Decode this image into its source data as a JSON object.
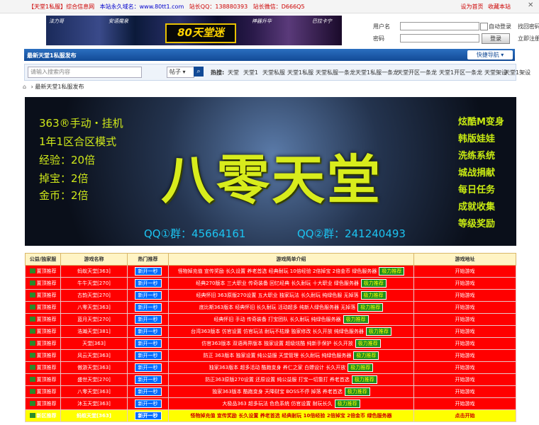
{
  "topbar": {
    "left": [
      "【天堂1私服】综合信息网",
      "本站永久域名：www.80tt1.com",
      "站长QQ：138880393",
      "站长微信：D666Q5"
    ],
    "right": [
      "设为首页",
      "收藏本站"
    ],
    "icon": "close-icon"
  },
  "banner": {
    "tags": [
      "法力哥",
      "安语魔泉",
      "神器升华",
      "巴拉卡宁"
    ],
    "logo": "80天堂迷"
  },
  "login": {
    "username_label": "用户名",
    "password_label": "密码",
    "auto_login": "自动登录",
    "find_password": "找回密码",
    "login_button": "登录",
    "register": "立即注册"
  },
  "navbar": {
    "title": "最新天堂1私服发布",
    "quick_nav": "快捷导航 ▾"
  },
  "search": {
    "placeholder": "请输入搜索内容",
    "select": "帖子 ▾",
    "hot_label": "热搜:",
    "hot_keywords": [
      "天堂",
      "天堂1",
      "天堂私服",
      "天堂1私服",
      "天堂私服一条龙",
      "天堂1私服一条龙",
      "天堂开区一条龙",
      "天堂1开区一条龙",
      "天堂架设",
      "天堂1架设"
    ]
  },
  "breadcrumb": {
    "separator": "›",
    "current": "最新天堂1私服发布"
  },
  "ad": {
    "left_lines": [
      "363®手动・挂机",
      "1年1区合区模式",
      "经验：20倍",
      "掉宝：2倍",
      "金币：2倍"
    ],
    "big": "八零天堂",
    "right_lines": [
      "炫酷M变身",
      "韩版娃娃",
      "洗练系统",
      "城战捐献",
      "每日任务",
      "成就收集",
      "等级奖励"
    ],
    "qq1": "QQ①群：45664161",
    "qq2": "QQ②群：241240493"
  },
  "table": {
    "headers": [
      "公益/独家服",
      "游戏名称",
      "热门推荐",
      "游戏简单介绍",
      "游戏地址"
    ],
    "rows": [
      {
        "tag": "置顶推荐",
        "name": "蚂蚁天堂[363]",
        "hot": "新开一秒",
        "desc": "怪物掉充值 宣传奖励 长久设置 养老首选 经典耐玩 10倍经验 2倍掉宝 2倍金币 绿色服务器",
        "rec": "极力推荐",
        "go": "开始游戏"
      },
      {
        "tag": "置顶推荐",
        "name": "牛牛天堂[270]",
        "hot": "新开一秒",
        "desc": "经典270版本 三大职业 传奇装备 回忆经典 长久耐玩 十大职业 绿色服务器",
        "rec": "极力推荐",
        "go": "开始游戏"
      },
      {
        "tag": "置顶推荐",
        "name": "古韵天堂[270]",
        "hot": "新开一秒",
        "desc": "经典怀旧 363原版270设置 五大职业 独家玩法 长久耐玩 纯绿色服 无掉落",
        "rec": "极力推荐",
        "go": "开始游戏"
      },
      {
        "tag": "置顶推荐",
        "name": "八零天堂[363]",
        "hot": "新开一秒",
        "desc": "底比斯363版本 经典怀旧 长久耐玩 活动超多 纯新人绿色服务器 无掉落",
        "rec": "极力推荐",
        "go": "开始游戏"
      },
      {
        "tag": "置顶推荐",
        "name": "蓝月天堂[270]",
        "hot": "新开一秒",
        "desc": "经典怀旧 手动 传奇装备 打宝团队 长久耐玩 纯绿色服务器",
        "rec": "极力推荐",
        "go": "开始游戏"
      },
      {
        "tag": "置顶推荐",
        "name": "浩瀚天堂[381]",
        "hot": "新开一秒",
        "desc": "台湾363版本 仿官设置 仿官玩法 耐玩不枯燥 独家修改 长久开放 纯绿色服务器",
        "rec": "极力推荐",
        "go": "开始游戏"
      },
      {
        "tag": "置顶推荐",
        "name": "天堂[363]",
        "hot": "新开一秒",
        "desc": "仿官363版本 双语两界版本 独家设置 超级炫酷 纯新手保护 长久开放",
        "rec": "极力推荐",
        "go": "开始游戏"
      },
      {
        "tag": "置顶推荐",
        "name": "风云天堂[363]",
        "hot": "新开一秒",
        "desc": "防正 363版本 独家设置 纯公益服 天堂管理 长久耐玩 纯绿色服务器",
        "rec": "极力推荐",
        "go": "开始游戏"
      },
      {
        "tag": "置顶推荐",
        "name": "傲游天堂[363]",
        "hot": "新开一秒",
        "desc": "独家363版本 超多活动 酷跑变身 养仁之家 白嫖设计 长久开放",
        "rec": "极力推荐",
        "go": "开始游戏"
      },
      {
        "tag": "置顶推荐",
        "name": "盛世天堂[270]",
        "hot": "新开一秒",
        "desc": "防正363原版270设置 还原设置 纯公益服 打宝一切靠打 养老首选",
        "rec": "极力推荐",
        "go": "开始游戏"
      },
      {
        "tag": "置顶推荐",
        "name": "八零天堂[363]",
        "hot": "新开一秒",
        "desc": "独家363版本 酷跑变身 天降财宝 BOSS不停 掉落 养老首选",
        "rec": "极力推荐",
        "go": "开始游戏"
      },
      {
        "tag": "置顶推荐",
        "name": "沐玉天堂[363]",
        "hot": "新开一秒",
        "desc": "大极品363 超多玩法 色色系统 仿官设置 耐玩长久",
        "rec": "极力推荐",
        "go": "开始游戏"
      },
      {
        "tag": "新区推荐",
        "name": "蚂蚁天堂[363]",
        "hot": "新开一秒",
        "desc": "怪物掉充值 宣传奖励 长久设置 养老首选 经典耐玩 10倍经验 2倍掉宝 2倍金币 绿色服务器",
        "rec": "",
        "go": "点击开始"
      }
    ]
  }
}
